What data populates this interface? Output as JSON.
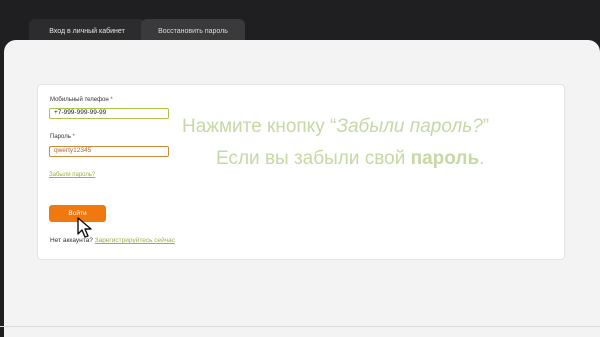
{
  "tabs": {
    "login": "Вход в личный кабинет",
    "restore": "Восстановить пароль"
  },
  "form": {
    "phone_label": "Мобильный телефон",
    "phone_value": "+7-999-999-99-99",
    "password_label": "Пароль",
    "password_value": "qwerty12345",
    "required_mark": "*",
    "forgot_link": "Забыли пароль?",
    "submit_label": "Войти",
    "no_account_text": "Нет аккаунта?",
    "register_link": "Зарегистрируйтесь сейчас"
  },
  "overlay": {
    "line1_prefix": "Нажмите кнопку “",
    "line1_emphasis": "Забыли пароль?",
    "line1_suffix": "”",
    "line2_prefix": "Если вы забыли свой ",
    "line2_bold": "пароль",
    "line2_suffix": "."
  },
  "colors": {
    "background": "#1f1f21",
    "accent_green": "#a9c44d",
    "button_orange": "#f0780f"
  },
  "icons": {
    "cursor": "mouse-pointer-icon"
  }
}
